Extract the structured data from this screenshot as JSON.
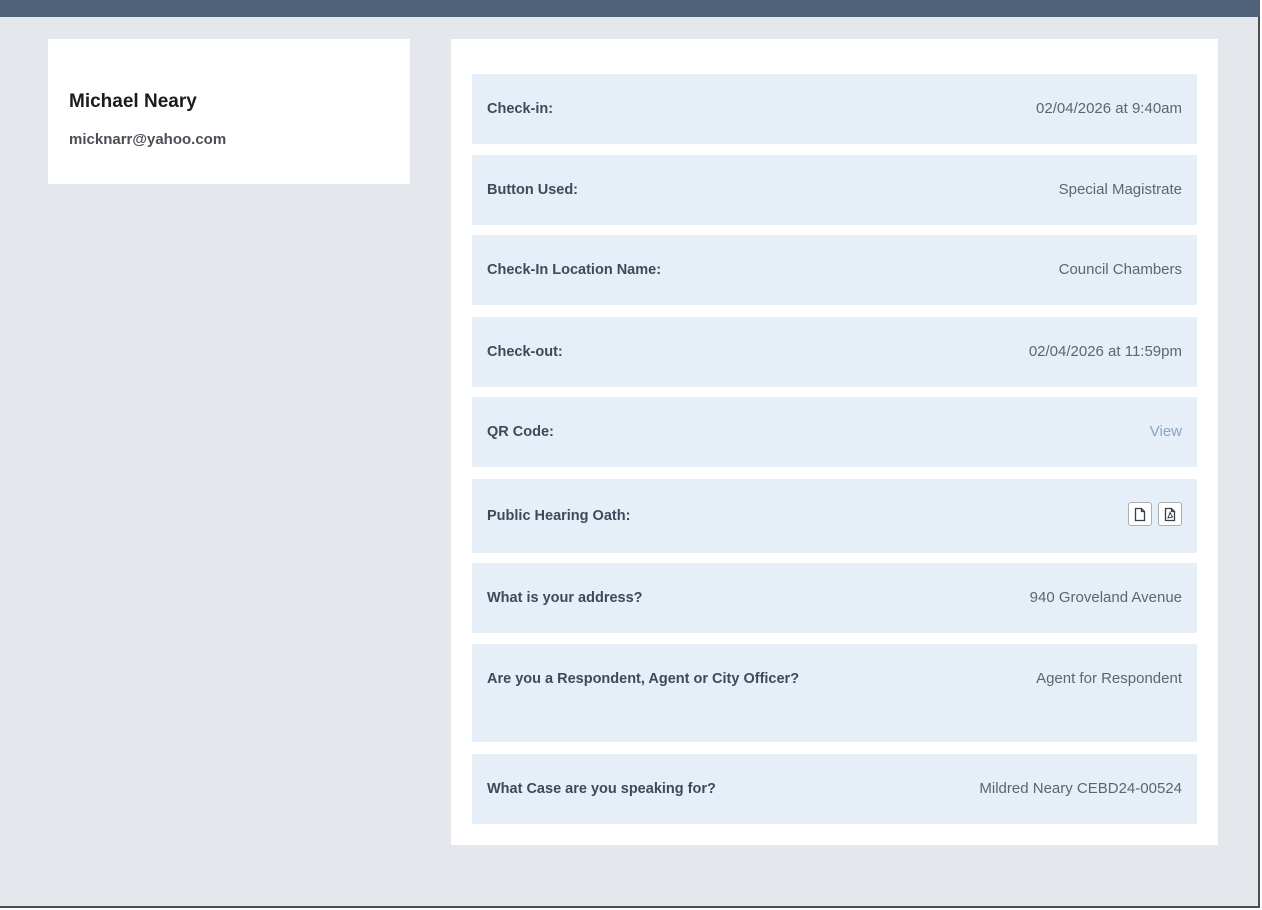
{
  "profile": {
    "name": "Michael Neary",
    "email": "micknarr@yahoo.com"
  },
  "details": {
    "check_in": {
      "label": "Check-in:",
      "value": "02/04/2026 at 9:40am"
    },
    "button_used": {
      "label": "Button Used:",
      "value": "Special Magistrate"
    },
    "location": {
      "label": "Check-In Location Name:",
      "value": "Council Chambers"
    },
    "check_out": {
      "label": "Check-out:",
      "value": "02/04/2026 at 11:59pm"
    },
    "qr_code": {
      "label": "QR Code:",
      "value": "View"
    },
    "oath": {
      "label": "Public Hearing Oath:",
      "icons": [
        "document-icon",
        "pdf-icon"
      ]
    },
    "address": {
      "label": "What is your address?",
      "value": "940 Groveland Avenue"
    },
    "role": {
      "label": "Are you a Respondent, Agent or City Officer?",
      "value": "Agent for Respondent"
    },
    "case": {
      "label": "What Case are you speaking for?",
      "value": "Mildred Neary CEBD24-00524"
    }
  },
  "colors": {
    "topbar": "#4e6178",
    "background": "#e4e8ec",
    "row_background": "#e6eef7",
    "link": "#8aa4c0"
  }
}
